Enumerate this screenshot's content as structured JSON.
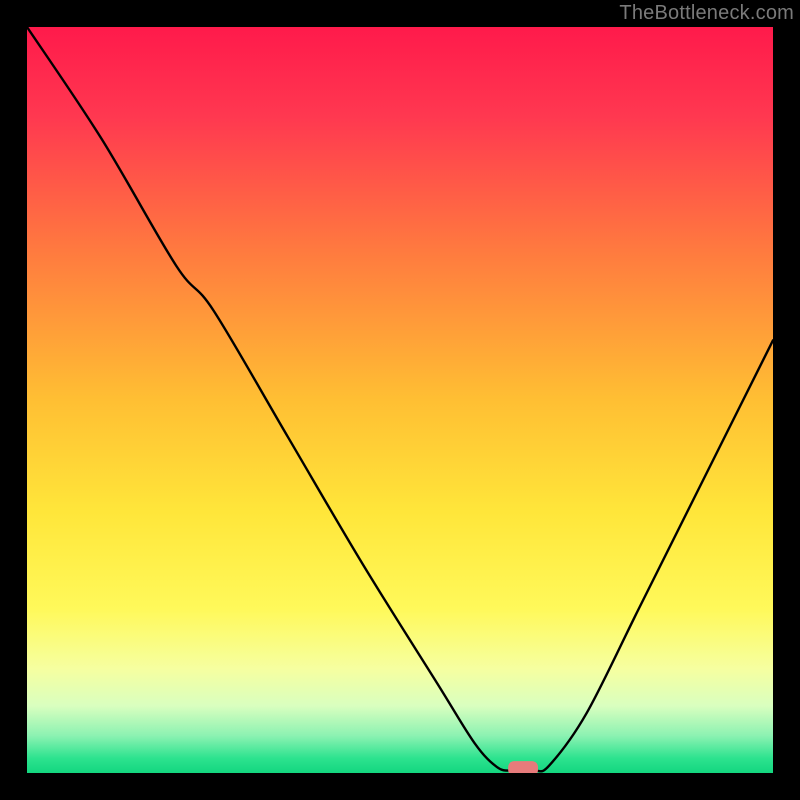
{
  "watermark": "TheBottleneck.com",
  "chart_data": {
    "type": "line",
    "title": "",
    "xlabel": "",
    "ylabel": "",
    "x_range": [
      0,
      100
    ],
    "y_range": [
      0,
      100
    ],
    "gradient_stops": [
      {
        "pct": 0,
        "color": "#ff1a4b"
      },
      {
        "pct": 12,
        "color": "#ff3850"
      },
      {
        "pct": 30,
        "color": "#ff7a3f"
      },
      {
        "pct": 50,
        "color": "#ffbf33"
      },
      {
        "pct": 65,
        "color": "#ffe63a"
      },
      {
        "pct": 78,
        "color": "#fff95a"
      },
      {
        "pct": 86,
        "color": "#f6ffa0"
      },
      {
        "pct": 91,
        "color": "#d9ffbf"
      },
      {
        "pct": 95,
        "color": "#8cf2b2"
      },
      {
        "pct": 98,
        "color": "#2de38f"
      },
      {
        "pct": 100,
        "color": "#13d67f"
      }
    ],
    "curve": [
      {
        "x": 0,
        "y": 100
      },
      {
        "x": 10,
        "y": 85
      },
      {
        "x": 20,
        "y": 68
      },
      {
        "x": 25,
        "y": 62
      },
      {
        "x": 35,
        "y": 45
      },
      {
        "x": 45,
        "y": 28
      },
      {
        "x": 55,
        "y": 12
      },
      {
        "x": 60,
        "y": 4
      },
      {
        "x": 63,
        "y": 0.8
      },
      {
        "x": 65,
        "y": 0.3
      },
      {
        "x": 68,
        "y": 0.3
      },
      {
        "x": 70,
        "y": 1.0
      },
      {
        "x": 75,
        "y": 8
      },
      {
        "x": 82,
        "y": 22
      },
      {
        "x": 90,
        "y": 38
      },
      {
        "x": 100,
        "y": 58
      }
    ],
    "marker": {
      "x": 66.5,
      "y": 0.6,
      "rx": 2.0,
      "ry": 1.0,
      "color": "#e77b7b"
    }
  }
}
